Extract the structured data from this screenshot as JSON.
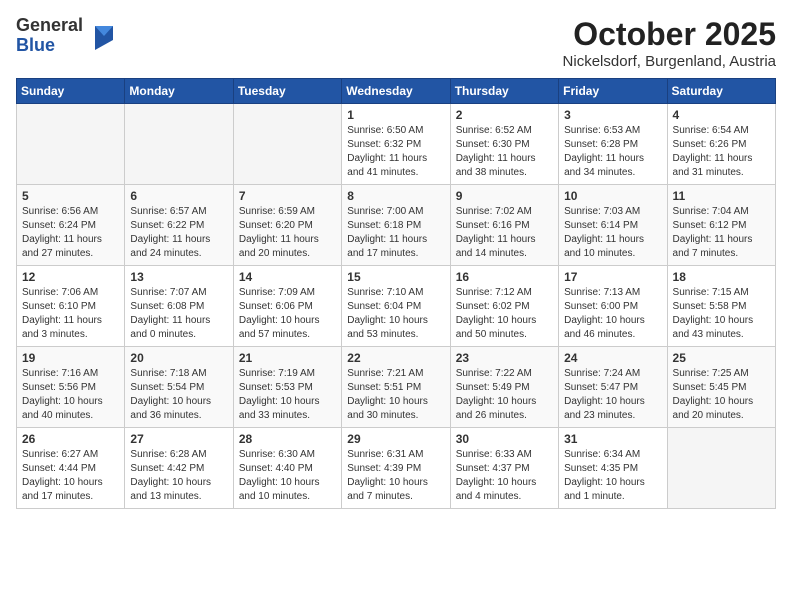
{
  "header": {
    "logo_general": "General",
    "logo_blue": "Blue",
    "month": "October 2025",
    "location": "Nickelsdorf, Burgenland, Austria"
  },
  "weekdays": [
    "Sunday",
    "Monday",
    "Tuesday",
    "Wednesday",
    "Thursday",
    "Friday",
    "Saturday"
  ],
  "weeks": [
    [
      {
        "day": "",
        "info": ""
      },
      {
        "day": "",
        "info": ""
      },
      {
        "day": "",
        "info": ""
      },
      {
        "day": "1",
        "info": "Sunrise: 6:50 AM\nSunset: 6:32 PM\nDaylight: 11 hours and 41 minutes."
      },
      {
        "day": "2",
        "info": "Sunrise: 6:52 AM\nSunset: 6:30 PM\nDaylight: 11 hours and 38 minutes."
      },
      {
        "day": "3",
        "info": "Sunrise: 6:53 AM\nSunset: 6:28 PM\nDaylight: 11 hours and 34 minutes."
      },
      {
        "day": "4",
        "info": "Sunrise: 6:54 AM\nSunset: 6:26 PM\nDaylight: 11 hours and 31 minutes."
      }
    ],
    [
      {
        "day": "5",
        "info": "Sunrise: 6:56 AM\nSunset: 6:24 PM\nDaylight: 11 hours and 27 minutes."
      },
      {
        "day": "6",
        "info": "Sunrise: 6:57 AM\nSunset: 6:22 PM\nDaylight: 11 hours and 24 minutes."
      },
      {
        "day": "7",
        "info": "Sunrise: 6:59 AM\nSunset: 6:20 PM\nDaylight: 11 hours and 20 minutes."
      },
      {
        "day": "8",
        "info": "Sunrise: 7:00 AM\nSunset: 6:18 PM\nDaylight: 11 hours and 17 minutes."
      },
      {
        "day": "9",
        "info": "Sunrise: 7:02 AM\nSunset: 6:16 PM\nDaylight: 11 hours and 14 minutes."
      },
      {
        "day": "10",
        "info": "Sunrise: 7:03 AM\nSunset: 6:14 PM\nDaylight: 11 hours and 10 minutes."
      },
      {
        "day": "11",
        "info": "Sunrise: 7:04 AM\nSunset: 6:12 PM\nDaylight: 11 hours and 7 minutes."
      }
    ],
    [
      {
        "day": "12",
        "info": "Sunrise: 7:06 AM\nSunset: 6:10 PM\nDaylight: 11 hours and 3 minutes."
      },
      {
        "day": "13",
        "info": "Sunrise: 7:07 AM\nSunset: 6:08 PM\nDaylight: 11 hours and 0 minutes."
      },
      {
        "day": "14",
        "info": "Sunrise: 7:09 AM\nSunset: 6:06 PM\nDaylight: 10 hours and 57 minutes."
      },
      {
        "day": "15",
        "info": "Sunrise: 7:10 AM\nSunset: 6:04 PM\nDaylight: 10 hours and 53 minutes."
      },
      {
        "day": "16",
        "info": "Sunrise: 7:12 AM\nSunset: 6:02 PM\nDaylight: 10 hours and 50 minutes."
      },
      {
        "day": "17",
        "info": "Sunrise: 7:13 AM\nSunset: 6:00 PM\nDaylight: 10 hours and 46 minutes."
      },
      {
        "day": "18",
        "info": "Sunrise: 7:15 AM\nSunset: 5:58 PM\nDaylight: 10 hours and 43 minutes."
      }
    ],
    [
      {
        "day": "19",
        "info": "Sunrise: 7:16 AM\nSunset: 5:56 PM\nDaylight: 10 hours and 40 minutes."
      },
      {
        "day": "20",
        "info": "Sunrise: 7:18 AM\nSunset: 5:54 PM\nDaylight: 10 hours and 36 minutes."
      },
      {
        "day": "21",
        "info": "Sunrise: 7:19 AM\nSunset: 5:53 PM\nDaylight: 10 hours and 33 minutes."
      },
      {
        "day": "22",
        "info": "Sunrise: 7:21 AM\nSunset: 5:51 PM\nDaylight: 10 hours and 30 minutes."
      },
      {
        "day": "23",
        "info": "Sunrise: 7:22 AM\nSunset: 5:49 PM\nDaylight: 10 hours and 26 minutes."
      },
      {
        "day": "24",
        "info": "Sunrise: 7:24 AM\nSunset: 5:47 PM\nDaylight: 10 hours and 23 minutes."
      },
      {
        "day": "25",
        "info": "Sunrise: 7:25 AM\nSunset: 5:45 PM\nDaylight: 10 hours and 20 minutes."
      }
    ],
    [
      {
        "day": "26",
        "info": "Sunrise: 6:27 AM\nSunset: 4:44 PM\nDaylight: 10 hours and 17 minutes."
      },
      {
        "day": "27",
        "info": "Sunrise: 6:28 AM\nSunset: 4:42 PM\nDaylight: 10 hours and 13 minutes."
      },
      {
        "day": "28",
        "info": "Sunrise: 6:30 AM\nSunset: 4:40 PM\nDaylight: 10 hours and 10 minutes."
      },
      {
        "day": "29",
        "info": "Sunrise: 6:31 AM\nSunset: 4:39 PM\nDaylight: 10 hours and 7 minutes."
      },
      {
        "day": "30",
        "info": "Sunrise: 6:33 AM\nSunset: 4:37 PM\nDaylight: 10 hours and 4 minutes."
      },
      {
        "day": "31",
        "info": "Sunrise: 6:34 AM\nSunset: 4:35 PM\nDaylight: 10 hours and 1 minute."
      },
      {
        "day": "",
        "info": ""
      }
    ]
  ]
}
